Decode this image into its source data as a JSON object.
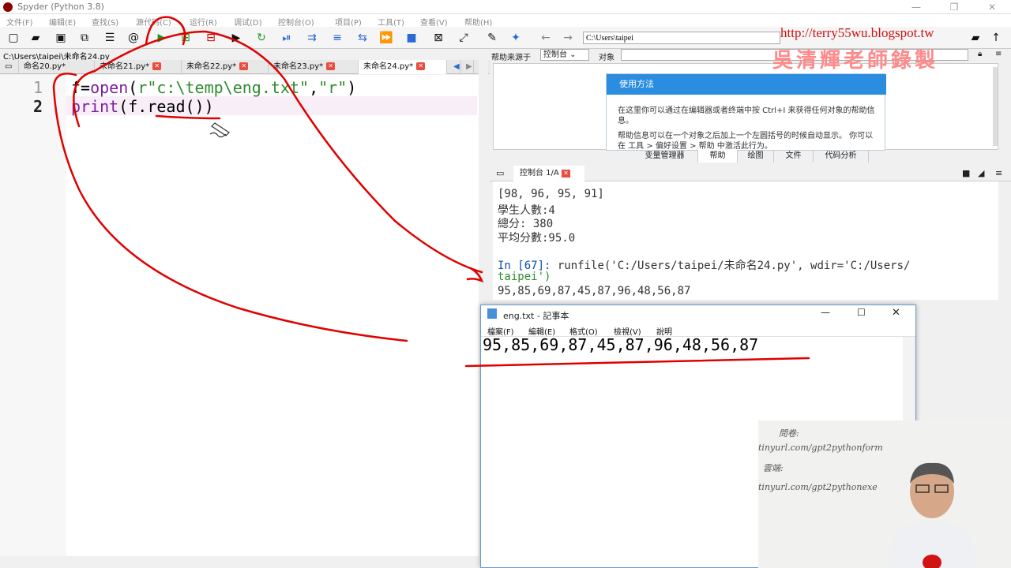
{
  "window": {
    "title": "Spyder (Python 3.8)",
    "controls": [
      "—",
      "❐",
      "✕"
    ]
  },
  "menubar": [
    "文件(F)",
    "编辑(E)",
    "查找(S)",
    "源代码(C)",
    "运行(R)",
    "调试(D)",
    "控制台(O)",
    "项目(P)",
    "工具(T)",
    "查看(V)",
    "帮助(H)"
  ],
  "toolbar": {
    "path_value": "C:\\Users\\taipei"
  },
  "editor": {
    "file_path": "C:\\Users\\taipei\\未命名24.py",
    "tabs": [
      {
        "label": "命名20.py*",
        "active": false
      },
      {
        "label": "未命名21.py*",
        "active": false
      },
      {
        "label": "未命名22.py*",
        "active": false
      },
      {
        "label": "未命名23.py*",
        "active": false
      },
      {
        "label": "未命名24.py*",
        "active": true
      }
    ],
    "lines": [
      {
        "num": "1",
        "tokens": [
          [
            "f=",
            ""
          ],
          [
            "open",
            "kw"
          ],
          [
            "(",
            ""
          ],
          [
            "r\"c:\\temp\\eng.txt\"",
            "str"
          ],
          [
            ",",
            ""
          ],
          [
            "\"r\"",
            "str"
          ],
          [
            ")",
            ""
          ]
        ]
      },
      {
        "num": "2",
        "tokens": [
          [
            "print",
            "kw"
          ],
          [
            "(f.read())",
            ""
          ]
        ]
      }
    ]
  },
  "help": {
    "source_label": "帮助来源于",
    "source_value": "控制台",
    "object_label": "对象",
    "card_title": "使用方法",
    "card_text1": "在这里你可以通过在编辑器或者终端中按 Ctrl+I 来获得任何对象的帮助信息。",
    "card_text2": "帮助信息可以在一个对象之后加上一个左圆括号的时候自动显示。 你可以在 工具 > 偏好设置 > 帮助 中激活此行为。",
    "panel_tabs": [
      "变量管理器",
      "帮助",
      "绘图",
      "文件",
      "代码分析"
    ]
  },
  "console": {
    "tab_label": "控制台 1/A",
    "lines": [
      {
        "text": "[98, 96, 95, 91]",
        "type": "out"
      },
      {
        "text": "學生人數:4",
        "type": "out"
      },
      {
        "text": "總分: 380",
        "type": "out"
      },
      {
        "text": "平均分數:95.0",
        "type": "out"
      },
      {
        "text": "",
        "type": "out"
      },
      {
        "text": "In [67]: runfile('C:/Users/taipei/未命名24.py', wdir='C:/Users/",
        "type": "in"
      },
      {
        "text": "taipei')",
        "type": "str"
      },
      {
        "text": "95,85,69,87,45,87,96,48,56,87",
        "type": "out"
      }
    ]
  },
  "notepad": {
    "title": "eng.txt - 記事本",
    "menu": [
      "檔案(F)",
      "編輯(E)",
      "格式(O)",
      "檢視(V)",
      "說明"
    ],
    "content": "95,85,69,87,45,87,96,48,56,87"
  },
  "watermark": {
    "url": "http://terry55wu.blogspot.tw",
    "name": "吳清輝老師錄製"
  },
  "whiteboard": {
    "lines": [
      "問卷:",
      "tinyurl.com/gpt2pythonform",
      "雲端:",
      "tinyurl.com/gpt2pythonexe"
    ]
  },
  "colors": {
    "keyword": "#7a1fa2",
    "string": "#2e8b2e",
    "annotation": "#e00000",
    "console_prompt": "#0a4ea8"
  }
}
